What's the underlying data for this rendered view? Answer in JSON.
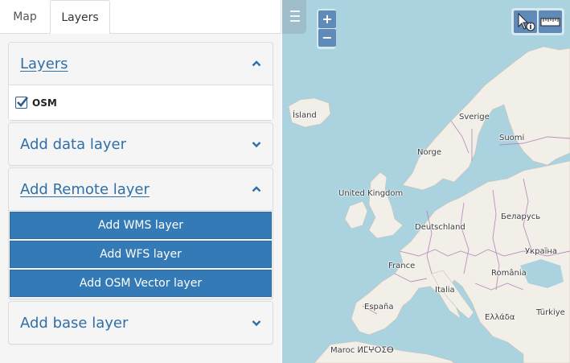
{
  "tabs": [
    {
      "label": "Map",
      "active": false
    },
    {
      "label": "Layers",
      "active": true
    }
  ],
  "layers_panel": {
    "title": "Layers",
    "expanded": true,
    "items": [
      {
        "name": "OSM",
        "checked": true
      }
    ]
  },
  "add_data_layer": {
    "title": "Add data layer",
    "expanded": false
  },
  "add_remote_layer": {
    "title": "Add Remote layer",
    "expanded": true,
    "buttons": [
      {
        "label": "Add WMS layer"
      },
      {
        "label": "Add WFS layer"
      },
      {
        "label": "Add OSM Vector layer"
      }
    ]
  },
  "add_base_layer": {
    "title": "Add base layer",
    "expanded": false
  },
  "map": {
    "zoom_in": "+",
    "zoom_out": "−",
    "labels": [
      {
        "id": "island",
        "text": "Ísland"
      },
      {
        "id": "norge",
        "text": "Norge"
      },
      {
        "id": "sverige",
        "text": "Sverige"
      },
      {
        "id": "suomi",
        "text": "Suomi"
      },
      {
        "id": "uk",
        "text": "United Kingdom"
      },
      {
        "id": "belarus",
        "text": "Беларусь"
      },
      {
        "id": "deutschland",
        "text": "Deutschland"
      },
      {
        "id": "ukraina",
        "text": "Україна"
      },
      {
        "id": "france",
        "text": "France"
      },
      {
        "id": "romania",
        "text": "România"
      },
      {
        "id": "italia",
        "text": "Italia"
      },
      {
        "id": "espana",
        "text": "España"
      },
      {
        "id": "turkiye",
        "text": "Türkiye"
      },
      {
        "id": "ellada",
        "text": "Ελλάδα"
      },
      {
        "id": "maroc",
        "text": "Maroc ⵍⵎⵖⵔⵉⴱ"
      }
    ],
    "colors": {
      "water": "#aad3df",
      "land": "#f2efe9",
      "border": "#b07fb5",
      "accent": "#337ab7"
    }
  }
}
